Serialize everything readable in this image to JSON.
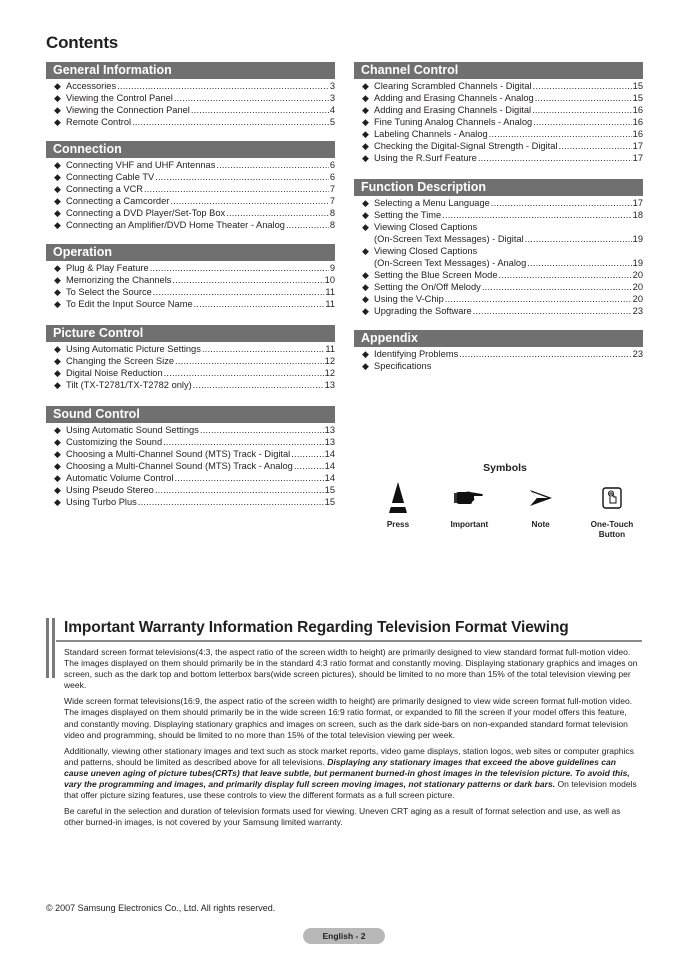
{
  "title": "Contents",
  "sections_left": [
    {
      "heading": "General Information",
      "items": [
        {
          "lines": [
            "Accessories"
          ],
          "page": "3"
        },
        {
          "lines": [
            "Viewing the Control Panel"
          ],
          "page": "3"
        },
        {
          "lines": [
            "Viewing the Connection Panel"
          ],
          "page": "4"
        },
        {
          "lines": [
            "Remote Control"
          ],
          "page": "5"
        }
      ]
    },
    {
      "heading": "Connection",
      "items": [
        {
          "lines": [
            "Connecting VHF and UHF Antennas"
          ],
          "page": "6"
        },
        {
          "lines": [
            "Connecting Cable TV"
          ],
          "page": "6"
        },
        {
          "lines": [
            "Connecting a VCR"
          ],
          "page": "7"
        },
        {
          "lines": [
            "Connecting a Camcorder"
          ],
          "page": "7"
        },
        {
          "lines": [
            "Connecting a DVD Player/Set-Top Box"
          ],
          "page": "8"
        },
        {
          "lines": [
            "Connecting an Amplifier/DVD Home Theater - Analog"
          ],
          "page": "8"
        }
      ]
    },
    {
      "heading": "Operation",
      "items": [
        {
          "lines": [
            "Plug & Play Feature"
          ],
          "page": "9"
        },
        {
          "lines": [
            "Memorizing the Channels"
          ],
          "page": "10"
        },
        {
          "lines": [
            "To Select the Source"
          ],
          "page": "11"
        },
        {
          "lines": [
            "To Edit the Input Source Name"
          ],
          "page": "11"
        }
      ]
    },
    {
      "heading": "Picture Control",
      "items": [
        {
          "lines": [
            "Using Automatic Picture Settings"
          ],
          "page": "11"
        },
        {
          "lines": [
            "Changing the Screen Size"
          ],
          "page": "12"
        },
        {
          "lines": [
            "Digital Noise Reduction"
          ],
          "page": "12"
        },
        {
          "lines": [
            "Tilt (TX-T2781/TX-T2782 only)"
          ],
          "page": "13"
        }
      ]
    },
    {
      "heading": "Sound Control",
      "items": [
        {
          "lines": [
            "Using Automatic Sound Settings"
          ],
          "page": "13"
        },
        {
          "lines": [
            "Customizing the Sound"
          ],
          "page": "13"
        },
        {
          "lines": [
            "Choosing a Multi-Channel Sound (MTS) Track - Digital"
          ],
          "page": "14"
        },
        {
          "lines": [
            "Choosing a Multi-Channel Sound (MTS) Track - Analog"
          ],
          "page": "14"
        },
        {
          "lines": [
            "Automatic Volume Control"
          ],
          "page": "14"
        },
        {
          "lines": [
            "Using Pseudo Stereo"
          ],
          "page": "15"
        },
        {
          "lines": [
            "Using Turbo Plus"
          ],
          "page": "15"
        }
      ]
    }
  ],
  "sections_right": [
    {
      "heading": "Channel Control",
      "items": [
        {
          "lines": [
            "Clearing Scrambled Channels - Digital"
          ],
          "page": "15"
        },
        {
          "lines": [
            "Adding and Erasing Channels - Analog"
          ],
          "page": "15"
        },
        {
          "lines": [
            "Adding and Erasing Channels - Digital"
          ],
          "page": "16"
        },
        {
          "lines": [
            "Fine Tuning Analog Channels - Analog"
          ],
          "page": "16"
        },
        {
          "lines": [
            "Labeling Channels - Analog"
          ],
          "page": "16"
        },
        {
          "lines": [
            "Checking the Digital-Signal Strength - Digital"
          ],
          "page": "17"
        },
        {
          "lines": [
            "Using the R.Surf Feature"
          ],
          "page": "17"
        }
      ]
    },
    {
      "heading": "Function Description",
      "items": [
        {
          "lines": [
            "Selecting a Menu Language"
          ],
          "page": "17"
        },
        {
          "lines": [
            "Setting the Time"
          ],
          "page": "18"
        },
        {
          "lines": [
            "Viewing Closed Captions",
            "(On-Screen Text Messages) - Digital"
          ],
          "page": "19"
        },
        {
          "lines": [
            "Viewing Closed Captions",
            "(On-Screen Text Messages) - Analog"
          ],
          "page": "19"
        },
        {
          "lines": [
            "Setting the Blue Screen Mode"
          ],
          "page": "20"
        },
        {
          "lines": [
            "Setting the On/Off Melody"
          ],
          "page": "20"
        },
        {
          "lines": [
            "Using the V-Chip"
          ],
          "page": "20"
        },
        {
          "lines": [
            "Upgrading the Software"
          ],
          "page": "23"
        }
      ]
    },
    {
      "heading": "Appendix",
      "items": [
        {
          "lines": [
            "Identifying Problems"
          ],
          "page": "23"
        },
        {
          "lines": [
            "Specifications"
          ],
          "page": ""
        }
      ]
    }
  ],
  "symbols": {
    "title": "Symbols",
    "items": [
      {
        "icon": "press-icon",
        "label": "Press"
      },
      {
        "icon": "pointing-hand-icon",
        "label": "Important"
      },
      {
        "icon": "note-arrow-icon",
        "label": "Note"
      },
      {
        "icon": "one-touch-button-icon",
        "label": "One-Touch Button"
      }
    ]
  },
  "warranty": {
    "title": "Important Warranty Information Regarding Television Format Viewing",
    "p1": "Standard screen format televisions(4:3, the aspect ratio of the screen width to height) are primarily designed to view standard format full-motion video. The images displayed on them should primarily be in the standard 4:3 ratio format and constantly moving. Displaying stationary graphics and images on screen, such as the dark top and bottom letterbox bars(wide screen pictures), should be limited to no more than 15% of the total television viewing per week.",
    "p2": "Wide screen format televisions(16:9, the aspect ratio of the screen width to height) are primarily designed to view wide screen format full-motion video. The images displayed on them should primarily be in the wide screen 16:9 ratio format, or expanded to fill the screen if your model offers this feature, and constantly moving. Displaying stationary graphics and images on screen, such as the dark side-bars on non-expanded standard format television video and programming, should be limited to no more than 15% of the total television viewing per week.",
    "p3_a": "Additionally, viewing other stationary images and text such as stock market reports, video game displays, station logos, web sites or computer graphics and patterns, should be limited as described above for all televisions. ",
    "p3_b": "Displaying any stationary images that exceed the above guidelines can cause uneven aging of picture tubes(CRTs) that leave subtle, but permanent burned-in ghost images in the television picture. To avoid this, vary the programming and images, and primarily display full screen moving images, not stationary patterns or dark bars.",
    "p3_c": " On television models that offer picture sizing features, use these controls to view the different formats as a full screen picture.",
    "p4": "Be careful in the selection and duration of television formats used for viewing. Uneven CRT aging as a result of format selection and use, as well as other burned-in images, is not covered by your Samsung limited warranty."
  },
  "footer": {
    "copyright": "© 2007 Samsung Electronics Co., Ltd. All rights reserved.",
    "page_label": "English - 2"
  },
  "bullet_glyph": "◆"
}
